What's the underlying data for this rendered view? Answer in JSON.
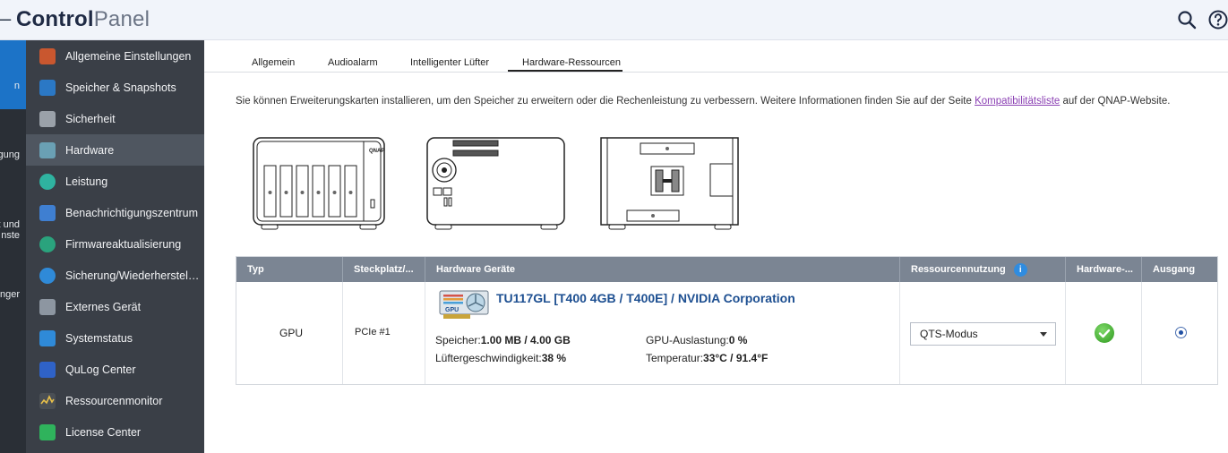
{
  "header": {
    "back_glyph": "–",
    "title_bold": "Control",
    "title_light": "Panel"
  },
  "leftcol": {
    "labels": [
      "n",
      "gung",
      "t und",
      "nste",
      "nger"
    ]
  },
  "sidebar": {
    "items": [
      {
        "label": "Allgemeine Einstellungen",
        "icon": "settings-icon",
        "color": "#c9572f"
      },
      {
        "label": "Speicher & Snapshots",
        "icon": "storage-icon",
        "color": "#2b78c5"
      },
      {
        "label": "Sicherheit",
        "icon": "lock-icon",
        "color": "#9aa1a9"
      },
      {
        "label": "Hardware",
        "icon": "hardware-icon",
        "color": "#6aa0b4"
      },
      {
        "label": "Leistung",
        "icon": "power-icon",
        "color": "#2fb3a0"
      },
      {
        "label": "Benachrichtigungszentrum",
        "icon": "notification-icon",
        "color": "#3f7fd1"
      },
      {
        "label": "Firmwareaktualisierung",
        "icon": "firmware-icon",
        "color": "#2aa37d"
      },
      {
        "label": "Sicherung/Wiederherstell...",
        "icon": "backup-icon",
        "color": "#2f8ad8"
      },
      {
        "label": "Externes Gerät",
        "icon": "external-device-icon",
        "color": "#8d96a1"
      },
      {
        "label": "Systemstatus",
        "icon": "system-status-icon",
        "color": "#2f8ad8"
      },
      {
        "label": "QuLog Center",
        "icon": "qulog-icon",
        "color": "#2f62c7"
      },
      {
        "label": "Ressourcenmonitor",
        "icon": "resource-monitor-icon",
        "color": "#4a4f55"
      },
      {
        "label": "License Center",
        "icon": "license-icon",
        "color": "#2fb35c"
      }
    ]
  },
  "tabs": [
    "Allgemein",
    "Audioalarm",
    "Intelligenter Lüfter",
    "Hardware-Ressourcen"
  ],
  "description": {
    "before": "Sie können Erweiterungskarten installieren, um den Speicher zu erweitern oder die Rechenleistung zu verbessern. Weitere Informationen finden Sie auf der Seite ",
    "link": "Kompatibilitätsliste",
    "after": " auf der QNAP-Website."
  },
  "device_front_logo": "QNAP",
  "table": {
    "headers": [
      "Typ",
      "Steckplatz/...",
      "Hardware Geräte",
      "Ressourcennutzung",
      "Hardware-...",
      "Ausgang"
    ],
    "info_glyph": "i",
    "row": {
      "type": "GPU",
      "slot": "PCIe #1",
      "card_badge": "GPU",
      "device_name": "TU117GL [T400 4GB / T400E] / NVIDIA Corporation",
      "memory_label": "Speicher:",
      "memory_value": "1.00 MB / 4.00 GB",
      "gpu_load_label": "GPU-Auslastung:",
      "gpu_load_value": "0 %",
      "fan_label": "Lüftergeschwindigkeit:",
      "fan_value": "38 %",
      "temp_label": "Temperatur:",
      "temp_value": "33°C / 91.4°F",
      "resource_mode": "QTS-Modus",
      "output_selected": true
    }
  }
}
